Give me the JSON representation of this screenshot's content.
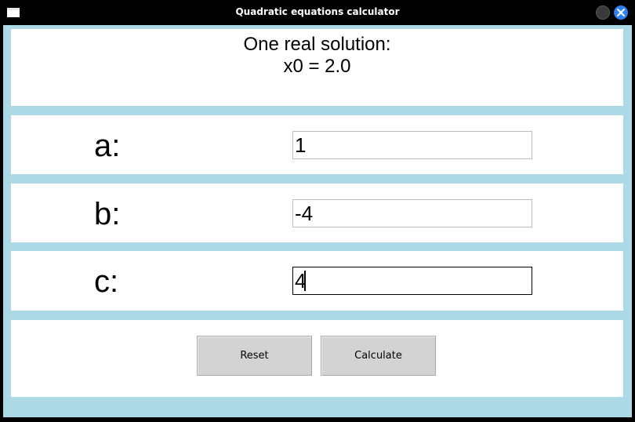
{
  "window": {
    "title": "Quadratic equations calculator",
    "icons": {
      "app": "window-app-icon",
      "minimize": "minimize-icon",
      "close": "close-icon"
    },
    "close_color": "#2f7ff0"
  },
  "result": {
    "line1": "One real solution:",
    "line2": "x0 = 2.0"
  },
  "inputs": [
    {
      "label": "a:",
      "value": "1",
      "focused": false
    },
    {
      "label": "b:",
      "value": "-4",
      "focused": false
    },
    {
      "label": "c:",
      "value": "4",
      "focused": true
    }
  ],
  "buttons": {
    "reset": "Reset",
    "calculate": "Calculate"
  },
  "colors": {
    "background": "#add8e6",
    "panel": "#ffffff",
    "button": "#d3d3d3"
  }
}
